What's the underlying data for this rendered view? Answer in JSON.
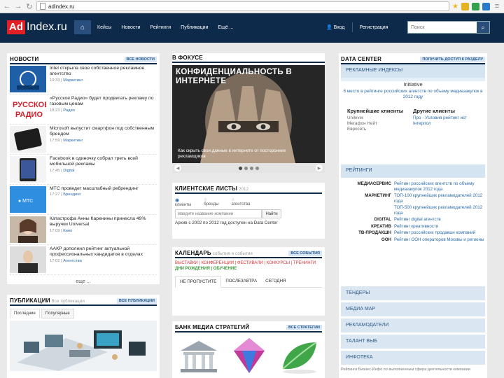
{
  "browser": {
    "url": "adindex.ru"
  },
  "header": {
    "logo_ad": "Ad",
    "logo_rest": "Index.ru",
    "nav": [
      "Кейсы",
      "Новости",
      "Рейтинги",
      "Публикации",
      "Ещё ..."
    ],
    "login": "Вход",
    "register": "Регистрация",
    "search_placeholder": "Поиск"
  },
  "news": {
    "title": "НОВОСТИ",
    "all_link": "ВСЕ НОВОСТИ",
    "items": [
      {
        "text": "Intel открыла свое собственное рекламное агентство",
        "time": "19:33",
        "cat": "Маркетинг",
        "thumb": "intel"
      },
      {
        "text": "«Русское Радио» будет продвигать рекламу по газовым ценам",
        "time": "18:23",
        "cat": "Радио",
        "thumb": "rr"
      },
      {
        "text": "Microsoft выпустит смартфон под собственным брендом",
        "time": "17:59",
        "cat": "Маркетинг",
        "thumb": "ms"
      },
      {
        "text": "Facebook в одиночку собрал треть всей мобильной рекламы",
        "time": "17:45",
        "cat": "Digital",
        "thumb": "fb"
      },
      {
        "text": "МТС проведет масштабный ребрендинг",
        "time": "17:27",
        "cat": "Брендинг",
        "thumb": "mts"
      },
      {
        "text": "Катастрофа Анны Каренины принесла 49% выручки Universal",
        "time": "17:09",
        "cat": "Кино",
        "thumb": "anna"
      },
      {
        "text": "ААКР дополнил рейтинг актуальной профессиональных кандидатов в отделах",
        "time": "17:02",
        "cat": "Агентства",
        "thumb": "aakr"
      }
    ],
    "more": "еще ..."
  },
  "publications": {
    "title": "ПУБЛИКАЦИИ",
    "subtitle": "Все публикации",
    "all_link": "ВСЕ ПУБЛИКАЦИИ",
    "tabs": [
      "Последние",
      "Популярные"
    ]
  },
  "focus": {
    "title": "В ФОКУСЕ",
    "headline": "КОНФИДЕНЦИАЛЬНОСТЬ В ИНТЕРНЕТЕ",
    "caption": "Как скрыть свои данные в интернете от посторонних рекламщиков"
  },
  "client_lists": {
    "title": "КЛИЕНТСКИЕ ЛИСТЫ",
    "count": "2012",
    "radios": [
      "клиенты",
      "бренды",
      "агентства"
    ],
    "placeholder": "Введите название компании",
    "button": "Найти",
    "note": "Архив с 2002 по 2012 год доступен на Data Center"
  },
  "calendar": {
    "title": "КАЛЕНДАРЬ",
    "subtitle": "события и события",
    "all_link": "ВСЕ СОБЫТИЯ",
    "links": "ВЫСТАВКИ | КОНФЕРЕНЦИИ | ФЕСТИВАЛИ | КОНКУРСЫ | ТРЕНИНГИ",
    "links2": "ДНИ РОЖДЕНИЯ | ОБУЧЕНИЕ",
    "tabs": [
      "НЕ ПРОПУСТИТЕ",
      "ПОСЛЕЗАВТРА",
      "СЕГОДНЯ"
    ]
  },
  "bank": {
    "title": "БАНК МЕДИА СТРАТЕГИЙ",
    "all_link": "ВСЕ СТРАТЕГИИ"
  },
  "datacenter": {
    "title": "DATA CENTER",
    "access_link": "ПОЛУЧИТЬ ДОСТУП К РАЗДЕЛУ",
    "sub1": "РЕКЛАМНЫЕ ИНДЕКСЫ",
    "initiative": "Initiative",
    "initiative_text": "6 место в рейтинге российских агентств по объему медиазакупок в 2012 году",
    "h_clients": "Крупнейшие клиенты",
    "h_other": "Другие клиенты",
    "clients": [
      "Unilever",
      "Мегафон Нейт",
      "Евросеть"
    ],
    "other": [
      "Про - Условия рейтинг ист",
      "Інтерпол"
    ],
    "sub2": "РЕЙТИНГИ",
    "ratings": [
      {
        "k": "МЕДИАСЕРВИС",
        "v": "Рейтинг российских агентств по объему медиазакупок 2012 года"
      },
      {
        "k": "МАРКЕТИНГ",
        "v": "ТОП-100 крупнейших рекламодателей 2012 года"
      },
      {
        "k": "",
        "v": "ТОП-500 крупнейших рекламодателей 2012 года"
      },
      {
        "k": "DIGITAL",
        "v": "Рейтинг digital агентств"
      },
      {
        "k": "КРЕАТИВ",
        "v": "Рейтинг креативности"
      },
      {
        "k": "ТВ-ПРОДАКШН",
        "v": "Рейтинг российских продакшн компаний"
      },
      {
        "k": "OOH",
        "v": "Рейтинг ООН операторов Москвы и регионы"
      }
    ],
    "accordions": [
      "ТЕНДЕРЫ",
      "МЕДИА МАР",
      "РЕКЛАМОДАТЕЛИ",
      "ТАЛАНТ ВЫБ",
      "ИНФОТЕКА"
    ],
    "footer_text": "Рейтинги Бизнес-Инфо по выполненным сфера деятельности компании"
  }
}
